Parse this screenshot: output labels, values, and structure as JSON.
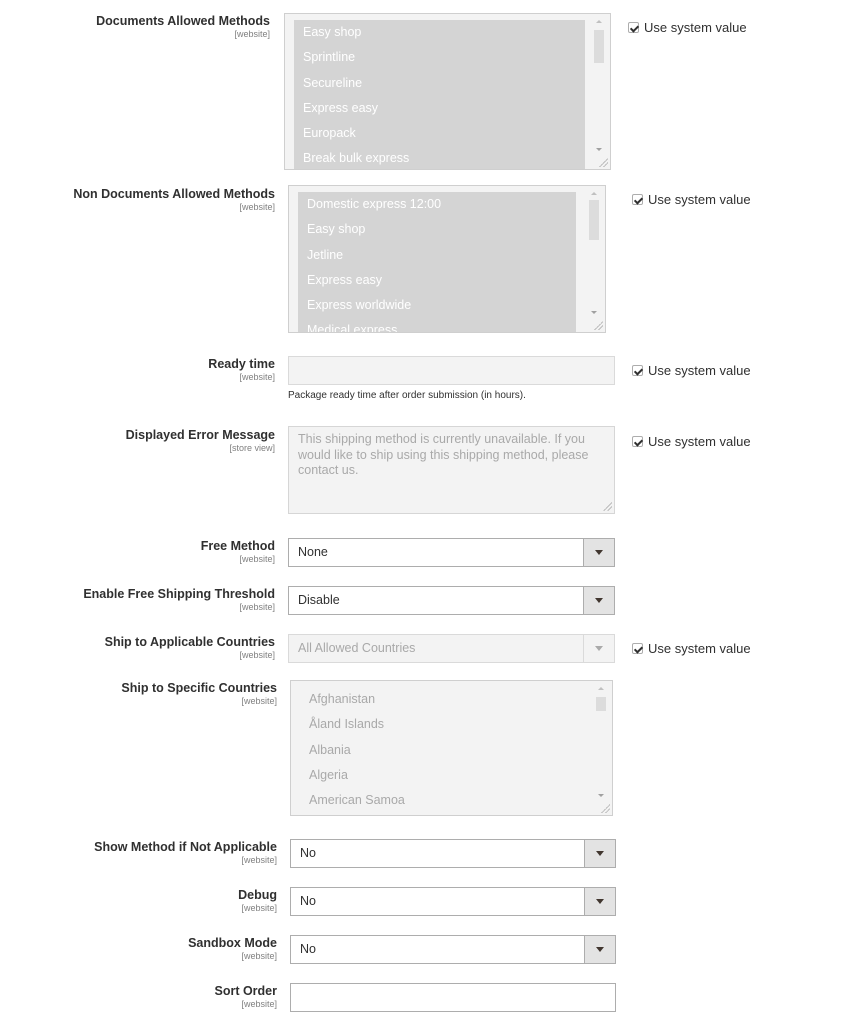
{
  "scope_labels": {
    "website": "[website]",
    "store_view": "[store view]"
  },
  "use_system_value_label": "Use system value",
  "fields": {
    "documents_allowed_methods": {
      "label": "Documents Allowed Methods",
      "scope": "[website]",
      "options": [
        "Easy shop",
        "Sprintline",
        "Secureline",
        "Express easy",
        "Europack",
        "Break bulk express"
      ],
      "use_system_value": true
    },
    "non_documents_allowed_methods": {
      "label": "Non Documents Allowed Methods",
      "scope": "[website]",
      "options": [
        "Domestic express 12:00",
        "Easy shop",
        "Jetline",
        "Express easy",
        "Express worldwide",
        "Medical express"
      ],
      "use_system_value": true
    },
    "ready_time": {
      "label": "Ready time",
      "scope": "[website]",
      "value": "",
      "note": "Package ready time after order submission (in hours).",
      "use_system_value": true
    },
    "displayed_error_message": {
      "label": "Displayed Error Message",
      "scope": "[store view]",
      "value": "This shipping method is currently unavailable. If you would like to ship using this shipping method, please contact us.",
      "use_system_value": true
    },
    "free_method": {
      "label": "Free Method",
      "scope": "[website]",
      "value": "None"
    },
    "enable_free_shipping_threshold": {
      "label": "Enable Free Shipping Threshold",
      "scope": "[website]",
      "value": "Disable"
    },
    "ship_to_applicable_countries": {
      "label": "Ship to Applicable Countries",
      "scope": "[website]",
      "value": "All Allowed Countries",
      "use_system_value": true
    },
    "ship_to_specific_countries": {
      "label": "Ship to Specific Countries",
      "scope": "[website]",
      "options": [
        "Afghanistan",
        "Åland Islands",
        "Albania",
        "Algeria",
        "American Samoa"
      ]
    },
    "show_method_if_not_applicable": {
      "label": "Show Method if Not Applicable",
      "scope": "[website]",
      "value": "No"
    },
    "debug": {
      "label": "Debug",
      "scope": "[website]",
      "value": "No"
    },
    "sandbox_mode": {
      "label": "Sandbox Mode",
      "scope": "[website]",
      "value": "No"
    },
    "sort_order": {
      "label": "Sort Order",
      "scope": "[website]",
      "value": ""
    }
  },
  "colors": {
    "selected_option_bg": "#d4d4d4",
    "disabled_field_bg": "#f3f3f3",
    "select_arrow_bg": "#e3e3e3",
    "text": "#303030",
    "muted_text": "#a9a9a9"
  }
}
